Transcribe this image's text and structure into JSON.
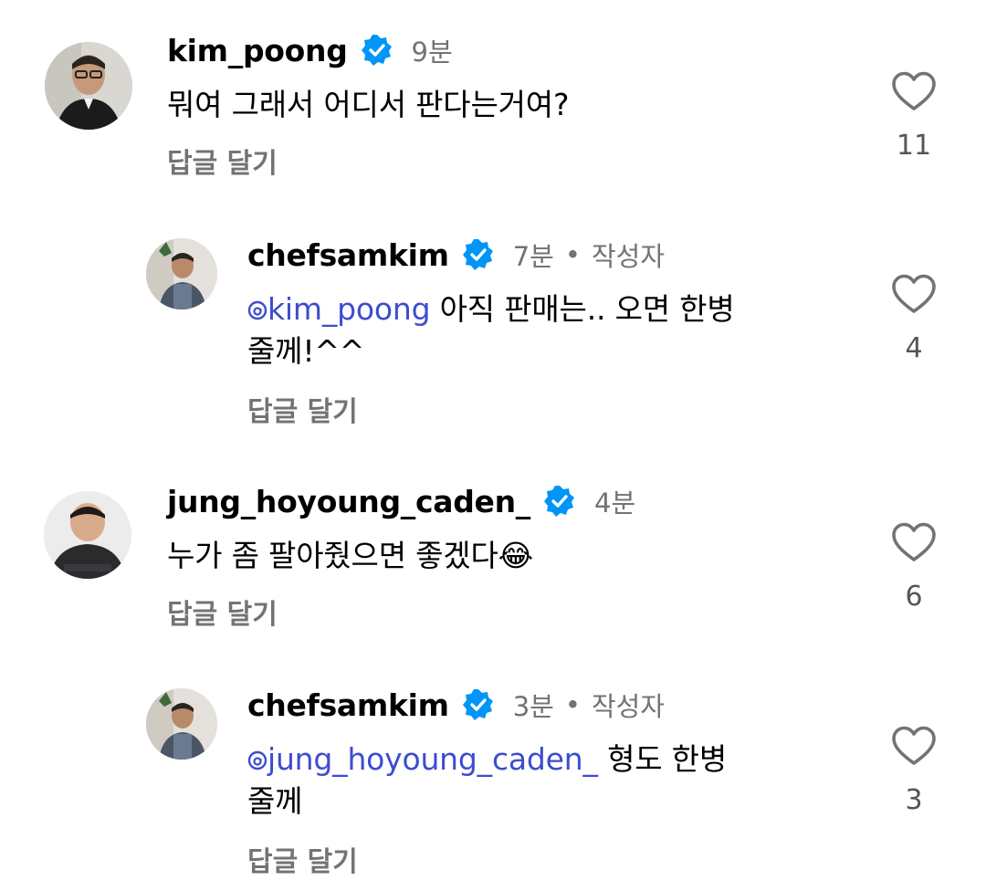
{
  "comments": [
    {
      "username": "kim_poong",
      "time": "9분",
      "text": "뭐여 그래서 어디서 판다는거여?",
      "reply_label": "답글 달기",
      "likes": "11"
    },
    {
      "username": "chefsamkim",
      "time": "7분",
      "author_tag": "작성자",
      "separator": "•",
      "mention": "kim_poong",
      "text_line1": " 아직 판매는.. 오면 한병",
      "text_line2": "줄께!^^",
      "reply_label": "답글 달기",
      "likes": "4"
    },
    {
      "username": "jung_hoyoung_caden_",
      "time": "4분",
      "text": "누가 좀 팔아줬으면 좋겠다😂",
      "reply_label": "답글 달기",
      "likes": "6"
    },
    {
      "username": "chefsamkim",
      "time": "3분",
      "author_tag": "작성자",
      "separator": "•",
      "mention": "jung_hoyoung_caden_",
      "text_line1": " 형도 한병",
      "text_line2": "줄께",
      "reply_label": "답글 달기",
      "likes": "3"
    }
  ],
  "colors": {
    "verified": "#0095f6",
    "mention": "#3d4ccf",
    "muted": "#737373"
  },
  "icons": {
    "verified": "verified-badge-icon",
    "like": "heart-outline-icon",
    "mention": "threads-at-icon"
  }
}
